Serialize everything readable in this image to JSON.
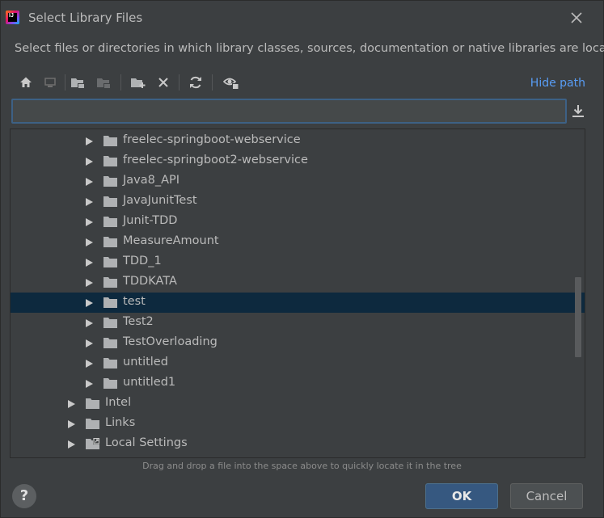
{
  "window": {
    "title": "Select Library Files",
    "subtitle": "Select files or directories in which library classes, sources, documentation or native libraries are located",
    "app_icon_text": "IJ"
  },
  "toolbar": {
    "icons": [
      "home-icon",
      "desktop-icon",
      "project-folder-icon",
      "module-folder-icon",
      "new-folder-icon",
      "delete-icon",
      "refresh-icon",
      "show-hidden-icon"
    ],
    "hide_path_label": "Hide path"
  },
  "path_input": {
    "value": "",
    "placeholder": ""
  },
  "tree": {
    "rows": [
      {
        "label": "freelec-springboot-webservice",
        "level": 2,
        "selected": false,
        "special": false
      },
      {
        "label": "freelec-springboot2-webservice",
        "level": 2,
        "selected": false,
        "special": false
      },
      {
        "label": "Java8_API",
        "level": 2,
        "selected": false,
        "special": false
      },
      {
        "label": "JavaJunitTest",
        "level": 2,
        "selected": false,
        "special": false
      },
      {
        "label": "Junit-TDD",
        "level": 2,
        "selected": false,
        "special": false
      },
      {
        "label": "MeasureAmount",
        "level": 2,
        "selected": false,
        "special": false
      },
      {
        "label": "TDD_1",
        "level": 2,
        "selected": false,
        "special": false
      },
      {
        "label": "TDDKATA",
        "level": 2,
        "selected": false,
        "special": false
      },
      {
        "label": "test",
        "level": 2,
        "selected": true,
        "special": false
      },
      {
        "label": "Test2",
        "level": 2,
        "selected": false,
        "special": false
      },
      {
        "label": "TestOverloading",
        "level": 2,
        "selected": false,
        "special": false
      },
      {
        "label": "untitled",
        "level": 2,
        "selected": false,
        "special": false
      },
      {
        "label": "untitled1",
        "level": 2,
        "selected": false,
        "special": false
      },
      {
        "label": "Intel",
        "level": 1,
        "selected": false,
        "special": false
      },
      {
        "label": "Links",
        "level": 1,
        "selected": false,
        "special": false
      },
      {
        "label": "Local Settings",
        "level": 1,
        "selected": false,
        "special": true
      }
    ]
  },
  "hint": "Drag and drop a file into the space above to quickly locate it in the tree",
  "footer": {
    "help_label": "?",
    "ok_label": "OK",
    "cancel_label": "Cancel"
  },
  "colors": {
    "background": "#3c3f41",
    "selection": "#0d293e",
    "accent_link": "#589df6",
    "ok_button": "#365880",
    "folder": "#afb1b3"
  }
}
